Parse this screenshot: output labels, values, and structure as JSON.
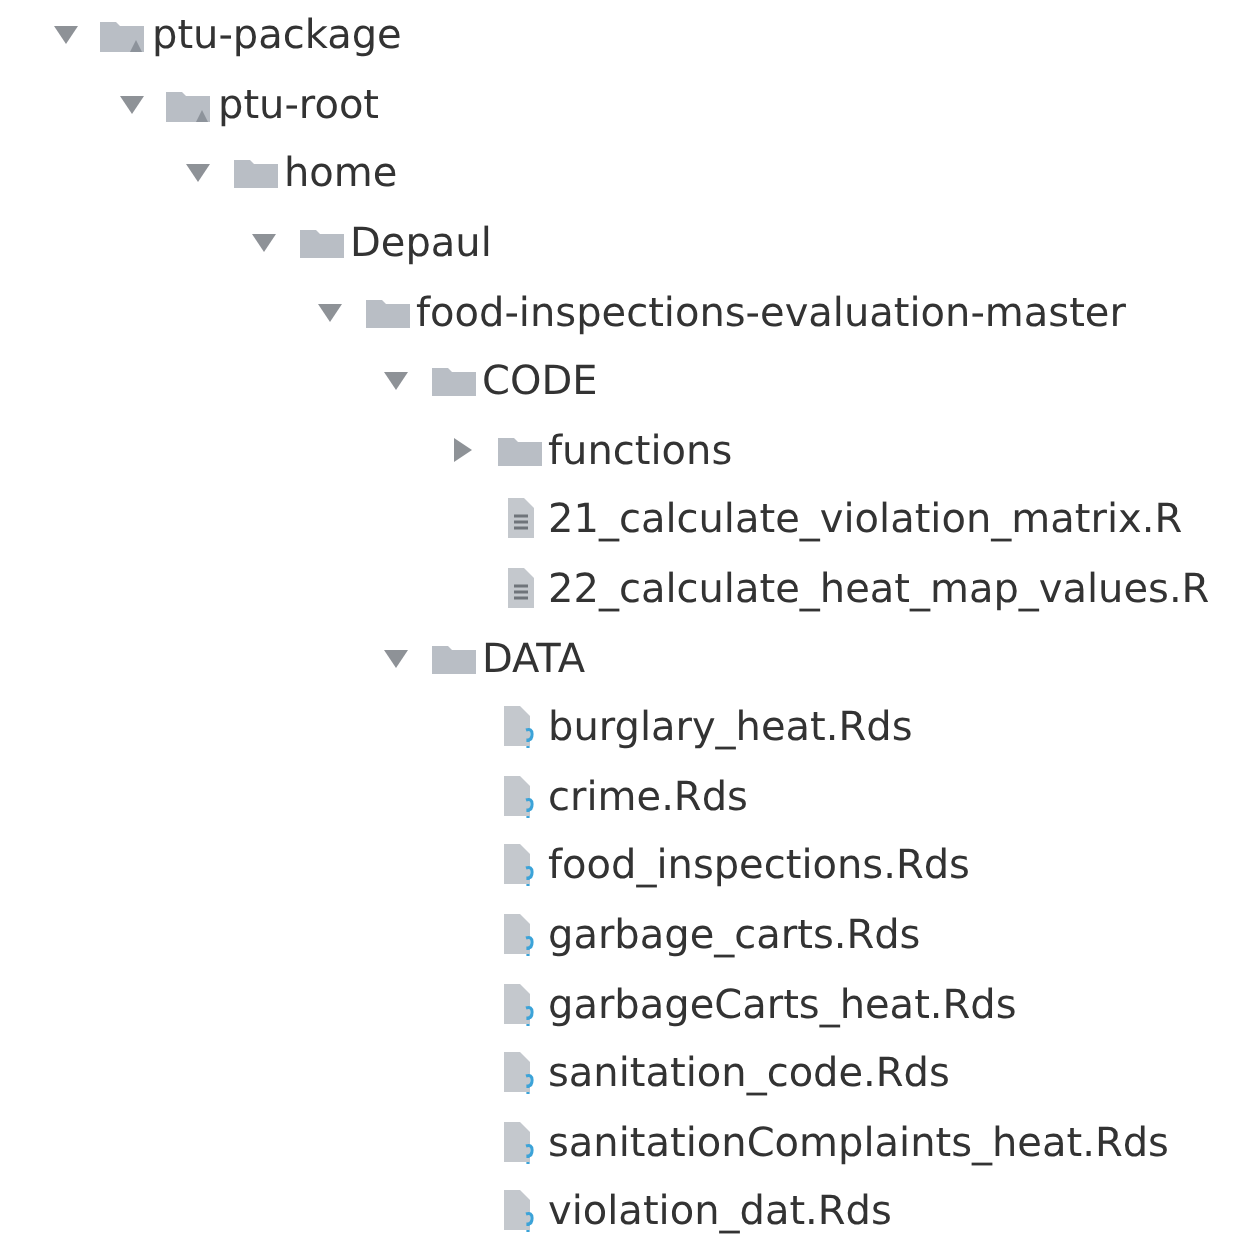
{
  "tree": [
    {
      "name": "ptu-package",
      "kind": "package",
      "expanded": true,
      "children": [
        {
          "name": "ptu-root",
          "kind": "package",
          "expanded": true,
          "children": [
            {
              "name": "home",
              "kind": "folder",
              "expanded": true,
              "children": [
                {
                  "name": "Depaul",
                  "kind": "folder",
                  "expanded": true,
                  "children": [
                    {
                      "name": "food-inspections-evaluation-master",
                      "kind": "folder",
                      "expanded": true,
                      "children": [
                        {
                          "name": "CODE",
                          "kind": "folder",
                          "expanded": true,
                          "children": [
                            {
                              "name": "functions",
                              "kind": "folder",
                              "expanded": false
                            },
                            {
                              "name": "21_calculate_violation_matrix.R",
                              "kind": "script"
                            },
                            {
                              "name": "22_calculate_heat_map_values.R",
                              "kind": "script"
                            }
                          ]
                        },
                        {
                          "name": "DATA",
                          "kind": "folder",
                          "expanded": true,
                          "children": [
                            {
                              "name": "burglary_heat.Rds",
                              "kind": "data"
                            },
                            {
                              "name": "crime.Rds",
                              "kind": "data"
                            },
                            {
                              "name": "food_inspections.Rds",
                              "kind": "data"
                            },
                            {
                              "name": "garbage_carts.Rds",
                              "kind": "data"
                            },
                            {
                              "name": "garbageCarts_heat.Rds",
                              "kind": "data"
                            },
                            {
                              "name": "sanitation_code.Rds",
                              "kind": "data"
                            },
                            {
                              "name": "sanitationComplaints_heat.Rds",
                              "kind": "data"
                            },
                            {
                              "name": "violation_dat.Rds",
                              "kind": "data"
                            }
                          ]
                        }
                      ]
                    }
                  ]
                }
              ]
            }
          ]
        }
      ]
    }
  ]
}
